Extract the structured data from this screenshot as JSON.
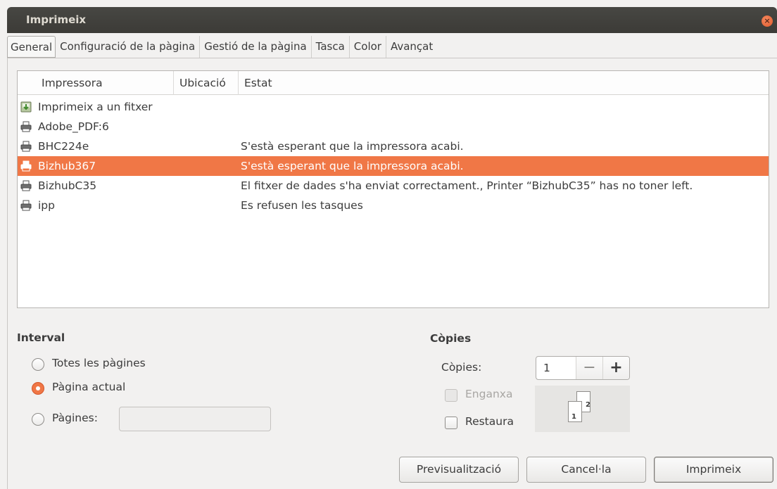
{
  "window": {
    "title": "Imprimeix"
  },
  "tabs": [
    {
      "label": "General",
      "active": true
    },
    {
      "label": "Configuració de la pàgina",
      "active": false
    },
    {
      "label": "Gestió de la pàgina",
      "active": false
    },
    {
      "label": "Tasca",
      "active": false
    },
    {
      "label": "Color",
      "active": false
    },
    {
      "label": "Avançat",
      "active": false
    }
  ],
  "printer_list": {
    "columns": [
      "Impressora",
      "Ubicació",
      "Estat"
    ],
    "rows": [
      {
        "name": "Imprimeix a un fitxer",
        "location": "",
        "status": "",
        "icon": "print-to-file-icon",
        "selected": false
      },
      {
        "name": "Adobe_PDF:6",
        "location": "",
        "status": "",
        "icon": "printer-icon",
        "selected": false
      },
      {
        "name": "BHC224e",
        "location": "",
        "status": "S'està esperant que la impressora acabi.",
        "icon": "printer-icon",
        "selected": false
      },
      {
        "name": "Bizhub367",
        "location": "",
        "status": "S'està esperant que la impressora acabi.",
        "icon": "printer-icon",
        "selected": true
      },
      {
        "name": "BizhubC35",
        "location": "",
        "status": "El fitxer de dades s'ha enviat correctament., Printer “BizhubC35” has no toner left.",
        "icon": "printer-icon",
        "selected": false
      },
      {
        "name": "ipp",
        "location": "",
        "status": "Es refusen les tasques",
        "icon": "printer-icon",
        "selected": false
      }
    ]
  },
  "range": {
    "title": "Interval",
    "all_pages": "Totes les pàgines",
    "current_page": "Pàgina actual",
    "pages": "Pàgines:",
    "pages_value": "",
    "selected": "current_page"
  },
  "copies": {
    "title": "Còpies",
    "label": "Còpies:",
    "value": "1",
    "minus": "−",
    "plus": "+",
    "collate": "Enganxa",
    "collate_enabled": false,
    "reverse": "Restaura",
    "reverse_checked": false,
    "preview_pages": [
      "1",
      "2"
    ]
  },
  "buttons": {
    "preview": "Previsualització",
    "cancel": "Cancel·la",
    "print": "Imprimeix"
  },
  "colors": {
    "accent": "#f07746",
    "titlebar": "#3c3b37",
    "background": "#f2f1f0"
  }
}
